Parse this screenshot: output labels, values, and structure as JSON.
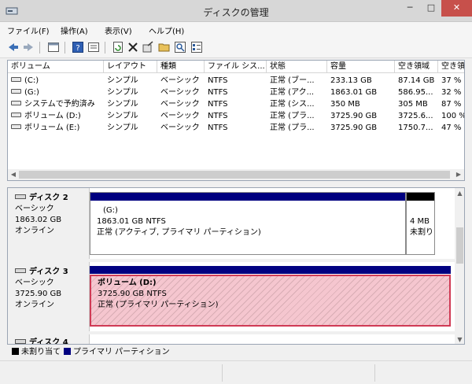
{
  "window": {
    "title": "ディスクの管理",
    "minimize_glyph": "─",
    "maximize_glyph": "□",
    "close_glyph": "✕"
  },
  "menu": [
    "ファイル(F)",
    "操作(A)",
    "表示(V)",
    "ヘルプ(H)"
  ],
  "toolbar": {
    "icons": [
      "back-icon",
      "forward-icon",
      "console-tree-icon",
      "help-icon",
      "properties-icon",
      "refresh-icon",
      "delete-icon",
      "settings-icon",
      "open-folder-icon",
      "search-icon",
      "properties-list-icon"
    ]
  },
  "volumes": {
    "columns": [
      "ボリューム",
      "レイアウト",
      "種類",
      "ファイル シス...",
      "状態",
      "容量",
      "空き領域",
      "空き領"
    ],
    "rows": [
      [
        "(C:)",
        "シンプル",
        "ベーシック",
        "NTFS",
        "正常 (ブー...",
        "233.13 GB",
        "87.14 GB",
        "37 %"
      ],
      [
        "(G:)",
        "シンプル",
        "ベーシック",
        "NTFS",
        "正常 (アク...",
        "1863.01 GB",
        "586.95...",
        "32 %"
      ],
      [
        "システムで予約済み",
        "シンプル",
        "ベーシック",
        "NTFS",
        "正常 (シス...",
        "350 MB",
        "305 MB",
        "87 %"
      ],
      [
        "ボリューム (D:)",
        "シンプル",
        "ベーシック",
        "NTFS",
        "正常 (プラ...",
        "3725.90 GB",
        "3725.6...",
        "100 %"
      ],
      [
        "ボリューム (E:)",
        "シンプル",
        "ベーシック",
        "NTFS",
        "正常 (プラ...",
        "3725.90 GB",
        "1750.7...",
        "47 %"
      ]
    ]
  },
  "disks": [
    {
      "name": "ディスク 2",
      "type": "ベーシック",
      "size": "1863.02 GB",
      "status": "オンライン",
      "partitions": [
        {
          "title": "(G:)",
          "detail": "1863.01 GB NTFS",
          "status": "正常 (アクティブ, プライマリ パーティション)",
          "kind": "primary"
        },
        {
          "title": "",
          "detail": "4 MB",
          "status": "未割り",
          "kind": "unallocated"
        }
      ]
    },
    {
      "name": "ディスク 3",
      "type": "ベーシック",
      "size": "3725.90 GB",
      "status": "オンライン",
      "partitions": [
        {
          "title": "ボリューム (D:)",
          "detail": "3725.90 GB NTFS",
          "status": "正常 (プライマリ パーティション)",
          "kind": "primary-selected"
        }
      ]
    },
    {
      "name": "ディスク 4"
    }
  ],
  "legend": [
    {
      "label": "未割り当て",
      "color": "#000000"
    },
    {
      "label": "プライマリ パーティション",
      "color": "#000080"
    }
  ],
  "colors": {
    "primary_band": "#000080",
    "unallocated_band": "#000000",
    "selection_border": "#d03a55",
    "selection_fill": "#f5c6cf",
    "close_button": "#c7504b"
  }
}
